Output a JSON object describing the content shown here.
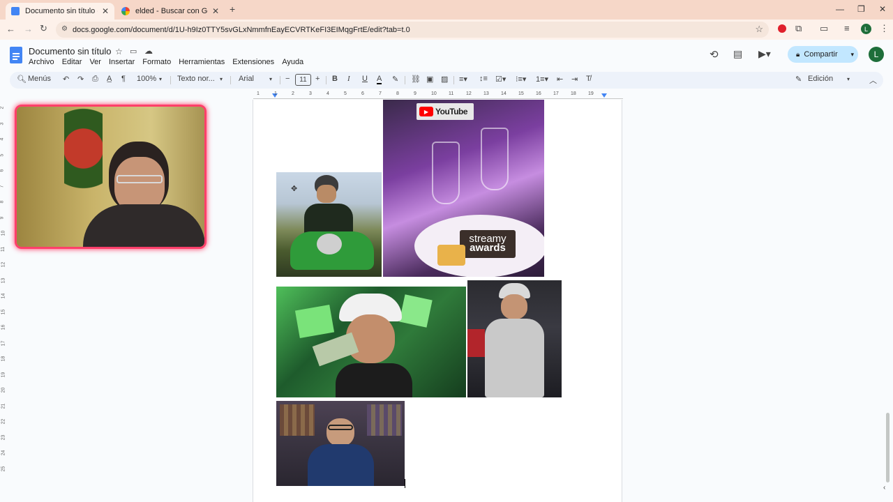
{
  "browser": {
    "tabs": [
      {
        "title": "Documento sin título - Docume",
        "active": true
      },
      {
        "title": "elded - Buscar con Google",
        "active": false
      }
    ],
    "url": "docs.google.com/document/d/1U-h9Iz0TTY5svGLxNmmfnEayECVRTKeFI3EIMqgFrtE/edit?tab=t.0",
    "profile_initial": "L"
  },
  "docs": {
    "title": "Documento sin título",
    "menu": [
      "Archivo",
      "Editar",
      "Ver",
      "Insertar",
      "Formato",
      "Herramientas",
      "Extensiones",
      "Ayuda"
    ],
    "share_label": "Compartir",
    "avatar_initial": "L",
    "toolbar": {
      "menus_label": "Menús",
      "zoom": "100%",
      "style": "Texto nor...",
      "font": "Arial",
      "font_size": "11",
      "mode": "Edición"
    },
    "ruler_marks": [
      "1",
      "1",
      "2",
      "3",
      "4",
      "5",
      "6",
      "7",
      "8",
      "9",
      "10",
      "11",
      "12",
      "13",
      "14",
      "15",
      "16",
      "17",
      "18",
      "19"
    ],
    "vruler_marks": [
      "2",
      "3",
      "4",
      "5",
      "6",
      "7",
      "8",
      "9",
      "10",
      "11",
      "12",
      "13",
      "14",
      "15",
      "16",
      "17",
      "18",
      "19",
      "20",
      "21",
      "22",
      "23",
      "24",
      "25"
    ],
    "images": {
      "youtube_logo": "YouTube",
      "streamy_line1": "streamy",
      "streamy_line2": "awards"
    }
  },
  "colors": {
    "tab_bar": "#f6d7c8",
    "share_button": "#c2e7ff",
    "webcam_border": "#ff3f6a",
    "docs_blue": "#4285f4"
  }
}
